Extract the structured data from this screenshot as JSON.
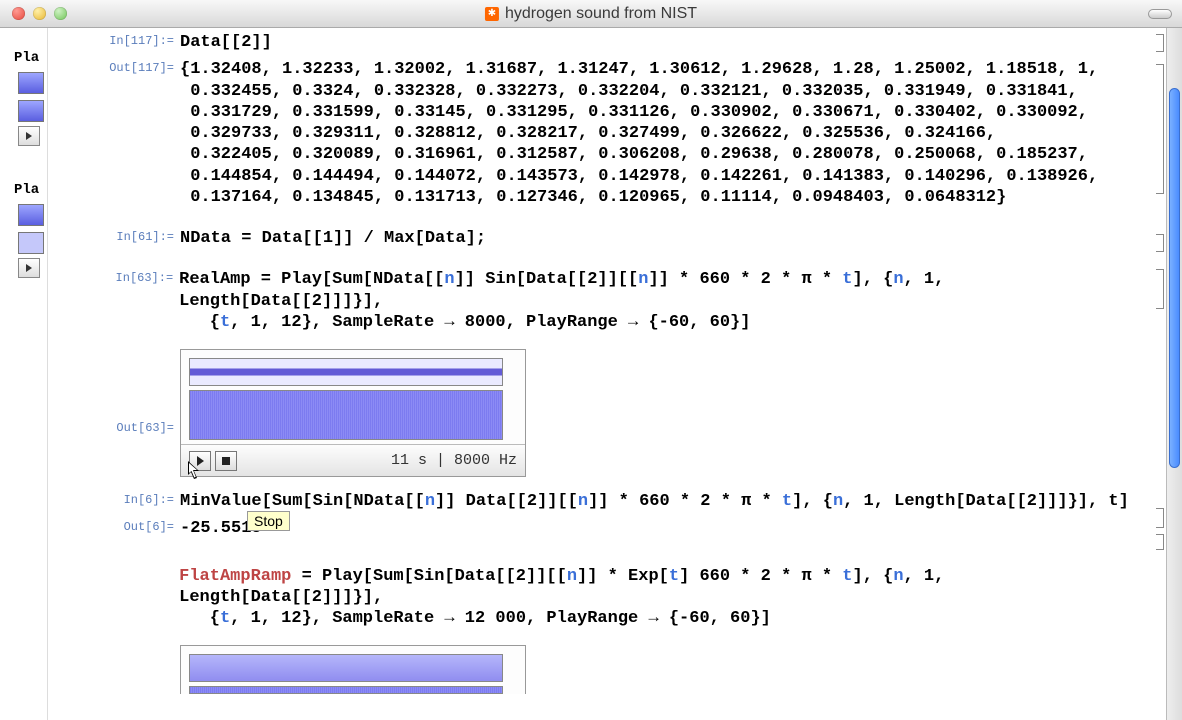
{
  "window": {
    "title": "hydrogen sound from NIST"
  },
  "left": {
    "lbl1": "Pla",
    "lbl2": "Pla"
  },
  "cells": {
    "in117_label": "In[117]:=",
    "in117_code": "Data[[2]]",
    "out117_label": "Out[117]=",
    "out117_text": "{1.32408, 1.32233, 1.32002, 1.31687, 1.31247, 1.30612, 1.29628, 1.28, 1.25002, 1.18518, 1,\n 0.332455, 0.3324, 0.332328, 0.332273, 0.332204, 0.332121, 0.332035, 0.331949, 0.331841,\n 0.331729, 0.331599, 0.33145, 0.331295, 0.331126, 0.330902, 0.330671, 0.330402, 0.330092,\n 0.329733, 0.329311, 0.328812, 0.328217, 0.327499, 0.326622, 0.325536, 0.324166,\n 0.322405, 0.320089, 0.316961, 0.312587, 0.306208, 0.29638, 0.280078, 0.250068, 0.185237,\n 0.144854, 0.144494, 0.144072, 0.143573, 0.142978, 0.142261, 0.141383, 0.140296, 0.138926,\n 0.137164, 0.134845, 0.131713, 0.127346, 0.120965, 0.11114, 0.0948403, 0.0648312}",
    "in61_label": "In[61]:=",
    "in61_code": "NData = Data[[1]] / Max[Data];",
    "in63_label": "In[63]:=",
    "in63_code_line1": "RealAmp = Play[Sum[NData[[",
    "in63_n1": "n",
    "in63_code_line1b": "]] Sin[Data[[2]][[",
    "in63_n2": "n",
    "in63_code_line1c": "]] * 660 * 2 * π * ",
    "in63_t1": "t",
    "in63_code_line1d": "], {",
    "in63_n3": "n",
    "in63_code_line1e": ", 1, Length[Data[[2]]]}],",
    "in63_code_line2a": "   {",
    "in63_t2": "t",
    "in63_code_line2b": ", 1, 12}, SampleRate → 8000, PlayRange → {-60, 60}]",
    "out63_label": "Out[63]=",
    "audio_info": "11 s | 8000 Hz",
    "tooltip": "Stop",
    "in6_label": "In[6]:=",
    "in6_code_a": "MinValue[Sum[Sin[NData[[",
    "in6_n1": "n",
    "in6_code_b": "]] Data[[2]][[",
    "in6_n2": "n",
    "in6_code_c": "]] * 660 * 2 * π * ",
    "in6_t1": "t",
    "in6_code_d": "], {",
    "in6_n3": "n",
    "in6_code_e": ", 1, Length[Data[[2]]]}], t]",
    "out6_label": "Out[6]=",
    "out6_text": "-25.5515",
    "flat_a": "FlatAmpRamp",
    "flat_b": " = Play[Sum[Sin[Data[[2]][[",
    "flat_n1": "n",
    "flat_c": "]] * Exp[",
    "flat_t1": "t",
    "flat_d": "] 660 * 2 * π * ",
    "flat_t2": "t",
    "flat_e": "], {",
    "flat_n2": "n",
    "flat_f": ", 1, Length[Data[[2]]]}],",
    "flat_line2a": "   {",
    "flat_t3": "t",
    "flat_line2b": ", 1, 12}, SampleRate → 12 000, PlayRange → {-60, 60}]"
  }
}
